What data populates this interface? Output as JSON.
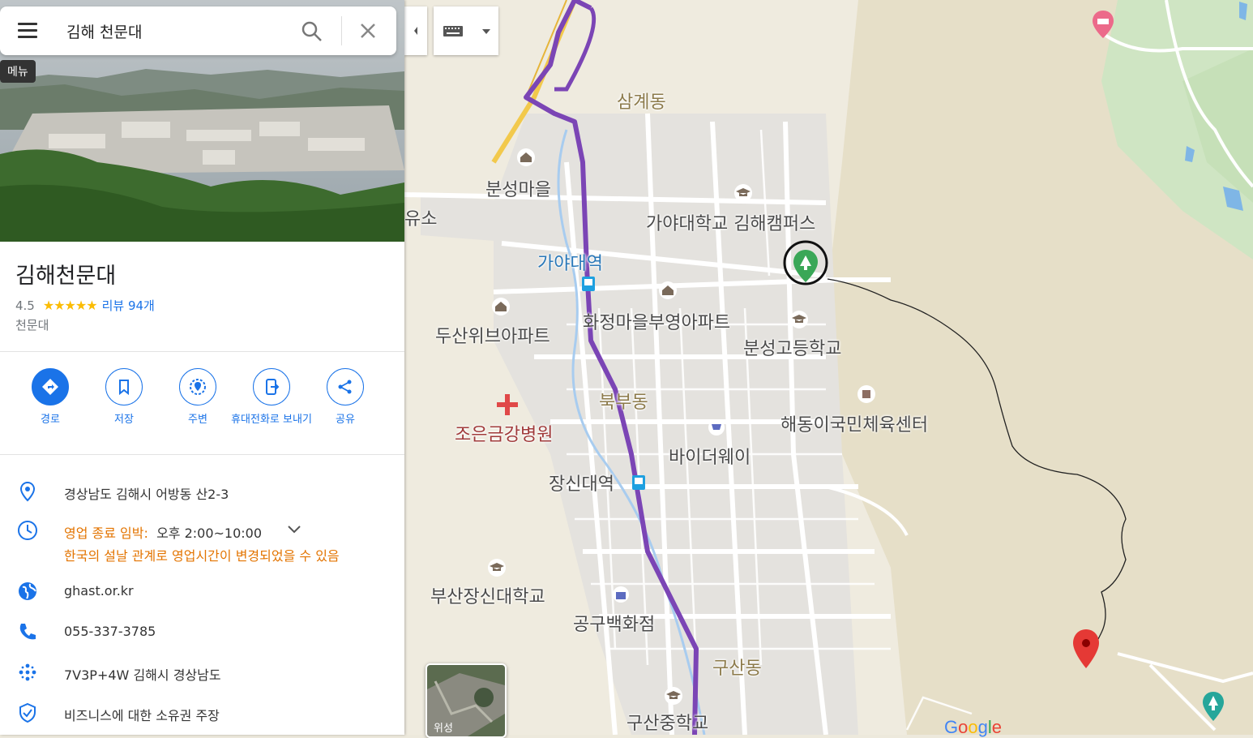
{
  "search": {
    "query": "김해 천문대",
    "menu_tooltip": "메뉴"
  },
  "place": {
    "title": "김해천문대",
    "rating": "4.5",
    "stars": "★★★★★",
    "reviews": "리뷰 94개",
    "category": "천문대"
  },
  "actions": [
    {
      "label": "경로",
      "icon": "directions-icon"
    },
    {
      "label": "저장",
      "icon": "bookmark-icon"
    },
    {
      "label": "주변",
      "icon": "nearby-icon"
    },
    {
      "label": "휴대전화로 보내기",
      "icon": "send-to-phone-icon"
    },
    {
      "label": "공유",
      "icon": "share-icon"
    }
  ],
  "info": {
    "address": "경상남도 김해시 어방동 산2-3",
    "hours_status": "영업 종료 임박:",
    "hours_range": "오후 2:00~10:00",
    "hours_note": "한국의 설날 관계로 영업시간이 변경되었을 수 있음",
    "website": "ghast.or.kr",
    "phone": "055-337-3785",
    "plus_code": "7V3P+4W 김해시 경상남도",
    "claim": "비즈니스에 대한 소유권 주장"
  },
  "map": {
    "labels": {
      "samgye": "삼계동",
      "bunseong_village": "분성마을",
      "yuso": "유소",
      "gaya_campus": "가야대학교 김해캠퍼스",
      "gaya_station": "가야대역",
      "hwajeong_apt": "화정마을부영아파트",
      "doosan_apt": "두산위브아파트",
      "bunseong_high": "분성고등학교",
      "bukbu": "북부동",
      "haedongi_center": "해동이국민체육센터",
      "joeun_hospital": "조은금강병원",
      "biderway": "바이더웨이",
      "jangsin_station": "장신대역",
      "busan_jangsin_univ": "부산장신대학교",
      "gonggu_dept": "공구백화점",
      "gusan": "구산동",
      "gusan_middle": "구산중학교"
    },
    "satellite_label": "위성",
    "google_logo": "Google",
    "colors": {
      "route_purple": "#7b45b5",
      "highway_yellow": "#f2c94c",
      "pin_red": "#e53935",
      "park_green": "#3aa757",
      "accent_blue": "#1a73e8"
    }
  }
}
